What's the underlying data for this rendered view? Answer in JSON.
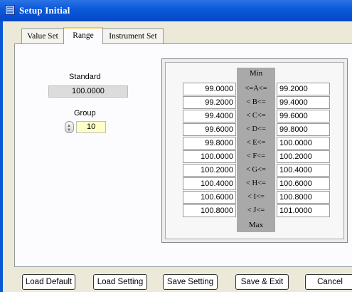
{
  "window": {
    "title": "Setup Initial"
  },
  "tabs": [
    {
      "label": "Value Set",
      "active": false
    },
    {
      "label": "Range",
      "active": true
    },
    {
      "label": "Instrument Set",
      "active": false
    }
  ],
  "standard": {
    "label": "Standard",
    "value": "100.0000"
  },
  "group": {
    "label": "Group",
    "value": "10"
  },
  "range_table": {
    "min_label": "Min",
    "max_label": "Max",
    "rows": [
      {
        "low": "99.0000",
        "condition": "<=A<=",
        "high": "99.2000"
      },
      {
        "low": "99.2000",
        "condition": "< B<=",
        "high": "99.4000"
      },
      {
        "low": "99.4000",
        "condition": "< C<=",
        "high": "99.6000"
      },
      {
        "low": "99.6000",
        "condition": "< D<=",
        "high": "99.8000"
      },
      {
        "low": "99.8000",
        "condition": "< E<=",
        "high": "100.0000"
      },
      {
        "low": "100.0000",
        "condition": "< F<=",
        "high": "100.2000"
      },
      {
        "low": "100.2000",
        "condition": "< G<=",
        "high": "100.4000"
      },
      {
        "low": "100.4000",
        "condition": "< H<=",
        "high": "100.6000"
      },
      {
        "low": "100.6000",
        "condition": "< I<=",
        "high": "100.8000"
      },
      {
        "low": "100.8000",
        "condition": "< J<=",
        "high": "101.0000"
      }
    ]
  },
  "buttons": {
    "load_default": "Load Default",
    "load_setting": "Load Setting",
    "save_setting": "Save Setting",
    "save_exit": "Save & Exit",
    "cancel": "Cancel"
  },
  "colors": {
    "titlebar": "#0a58d8",
    "group_field": "#ffffc8",
    "active_tab_accent": "#ffc83c"
  }
}
